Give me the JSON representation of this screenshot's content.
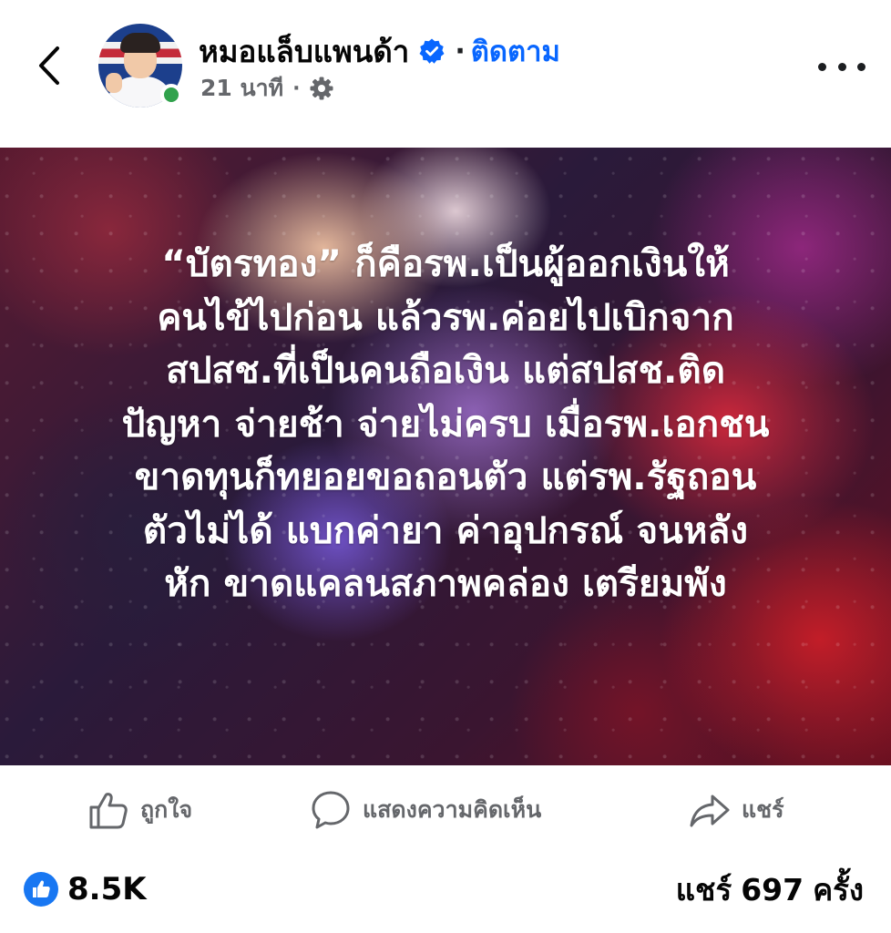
{
  "header": {
    "back_icon": "chevron-left-icon",
    "page_name": "หมอแล็บแพนด้า",
    "verified_icon": "verified-badge-icon",
    "separator": "·",
    "follow_label": "ติดตาม",
    "time_ago": "21 นาที",
    "meta_separator": "·",
    "audience_icon": "gear-icon",
    "more_icon": "more-horizontal-icon",
    "online_status_color": "#31a24c",
    "accent_color": "#0866ff"
  },
  "post": {
    "text_lines": [
      "“บัตรทอง” ก็คือรพ.เป็นผู้ออกเงินให้",
      "คนไข้ไปก่อน แล้วรพ.ค่อยไปเบิกจาก",
      "สปสช.ที่เป็นคนถือเงิน แต่สปสช.ติด",
      "ปัญหา จ่ายช้า จ่ายไม่ครบ เมื่อรพ.เอกชน",
      "ขาดทุนก็ทยอยขอถอนตัว แต่รพ.รัฐถอน",
      "ตัวไม่ได้ แบกค่ายา ค่าอุปกรณ์ จนหลัง",
      "หัก ขาดแคลนสภาพคล่อง เตรียมพัง"
    ]
  },
  "actions": {
    "like": {
      "icon": "thumbs-up-icon",
      "label": "ถูกใจ"
    },
    "comment": {
      "icon": "comment-bubble-icon",
      "label": "แสดงความคิดเห็น"
    },
    "share": {
      "icon": "share-arrow-icon",
      "label": "แชร์"
    }
  },
  "stats": {
    "reaction_icon": "like-reaction-icon",
    "reaction_count": "8.5K",
    "share_prefix": "แชร์",
    "share_count": "697",
    "share_suffix": "ครั้ง"
  }
}
